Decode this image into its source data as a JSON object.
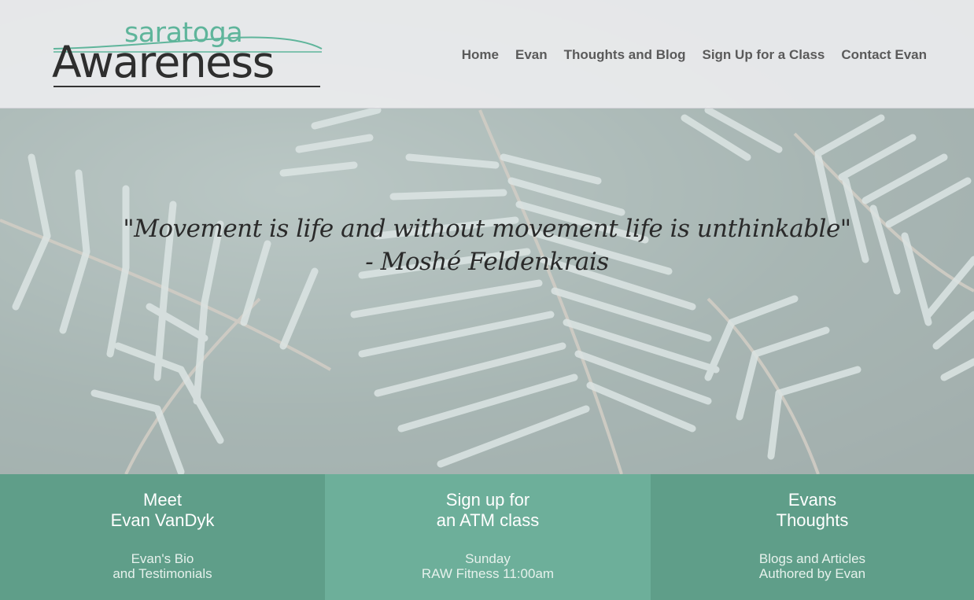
{
  "header": {
    "logo": {
      "top_text": "saratoga",
      "main_text": "Awareness"
    },
    "nav": [
      "Home",
      "Evan",
      "Thoughts and Blog",
      "Sign Up for a Class",
      "Contact Evan"
    ]
  },
  "hero": {
    "quote_line1": "\"Movement is life and without movement life is unthinkable\"",
    "quote_line2": "- Moshé Feldenkrais"
  },
  "panels": [
    {
      "title_line1": "Meet",
      "title_line2": "Evan VanDyk",
      "sub_line1": "Evan's Bio",
      "sub_line2": "and Testimonials"
    },
    {
      "title_line1": "Sign up for",
      "title_line2": "an ATM class",
      "sub_line1": "Sunday",
      "sub_line2": "RAW Fitness 11:00am"
    },
    {
      "title_line1": "Evans",
      "title_line2": "Thoughts",
      "sub_line1": "Blogs and Articles",
      "sub_line2": "Authored by Evan"
    }
  ],
  "colors": {
    "accent_green": "#5fb59b",
    "panel_dark": "#5f9e89",
    "panel_light": "#6daf9a",
    "nav_text": "#5a5a5a"
  }
}
